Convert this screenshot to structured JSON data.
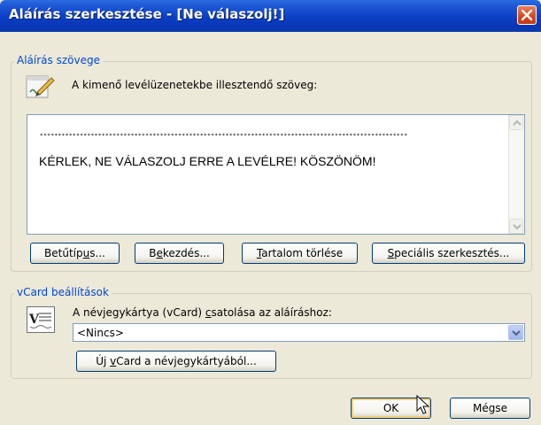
{
  "window": {
    "title": "Aláírás szerkesztése - [Ne válaszolj!]"
  },
  "signature_group": {
    "legend": "Aláírás szövege",
    "description": "A kimenő levélüzenetekbe illesztendő szöveg:",
    "icon": "signature-pen-icon",
    "editor": {
      "stars": "*****************************************************************************************************",
      "text": "KÉRLEK, NE VÁLASZOLJ ERRE A LEVÉLRE! KÖSZÖNÖM!"
    },
    "buttons": {
      "font": {
        "before": "Betűtíp",
        "mnemonic": "u",
        "after": "s..."
      },
      "paragraph": {
        "before": "B",
        "mnemonic": "e",
        "after": "kezdés..."
      },
      "clear": {
        "before": "",
        "mnemonic": "T",
        "after": "artalom törlése"
      },
      "advanced": {
        "before": "",
        "mnemonic": "S",
        "after": "peciális szerkesztés..."
      }
    }
  },
  "vcard_group": {
    "legend": "vCard beállítások",
    "icon": "vcard-icon",
    "attach_label": {
      "before": "A névjegykártya (vCard) ",
      "mnemonic": "c",
      "after": "satolása az aláíráshoz:"
    },
    "select_value": "<Nincs>",
    "new_vcard_button": {
      "before": "Új ",
      "mnemonic": "v",
      "after": "Card a névjegykártyából..."
    }
  },
  "footer": {
    "ok": "OK",
    "cancel": "Mégse"
  },
  "colors": {
    "title_bar": "#0a3fc4",
    "group_legend": "#0046d5",
    "close_button": "#d3471d",
    "dialog_bg": "#ece9d8"
  }
}
